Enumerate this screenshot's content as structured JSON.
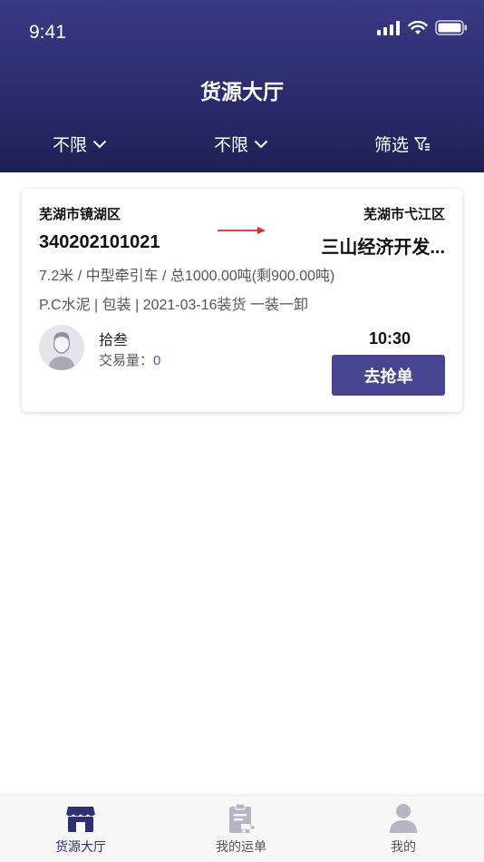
{
  "status_bar": {
    "time": "9:41"
  },
  "header": {
    "title": "货源大厅",
    "filters": [
      {
        "label": "不限"
      },
      {
        "label": "不限"
      },
      {
        "label": "筛选"
      }
    ]
  },
  "orders": [
    {
      "from_area": "芜湖市镜湖区",
      "from_code": "340202101021",
      "to_area": "芜湖市弋江区",
      "to_name": "三山经济开发...",
      "spec": "7.2米 / 中型牵引车 / 总1000.00吨(剩900.00吨)",
      "cargo": "P.C水泥 | 包装 | 2021-03-16装货  一装一卸",
      "user_name": "拾叁",
      "trade_label": "交易量：",
      "trade_count": "0",
      "time": "10:30",
      "action_label": "去抢单"
    }
  ],
  "tabbar": {
    "items": [
      {
        "label": "货源大厅",
        "icon": "store-icon",
        "active": true
      },
      {
        "label": "我的运单",
        "icon": "clipboard-truck-icon",
        "active": false
      },
      {
        "label": "我的",
        "icon": "user-icon",
        "active": false
      }
    ]
  },
  "colors": {
    "header_bg": "#2a2a6b",
    "button_bg": "#47458f",
    "arrow": "#d0312d",
    "trade_count": "#3d5bc9"
  }
}
